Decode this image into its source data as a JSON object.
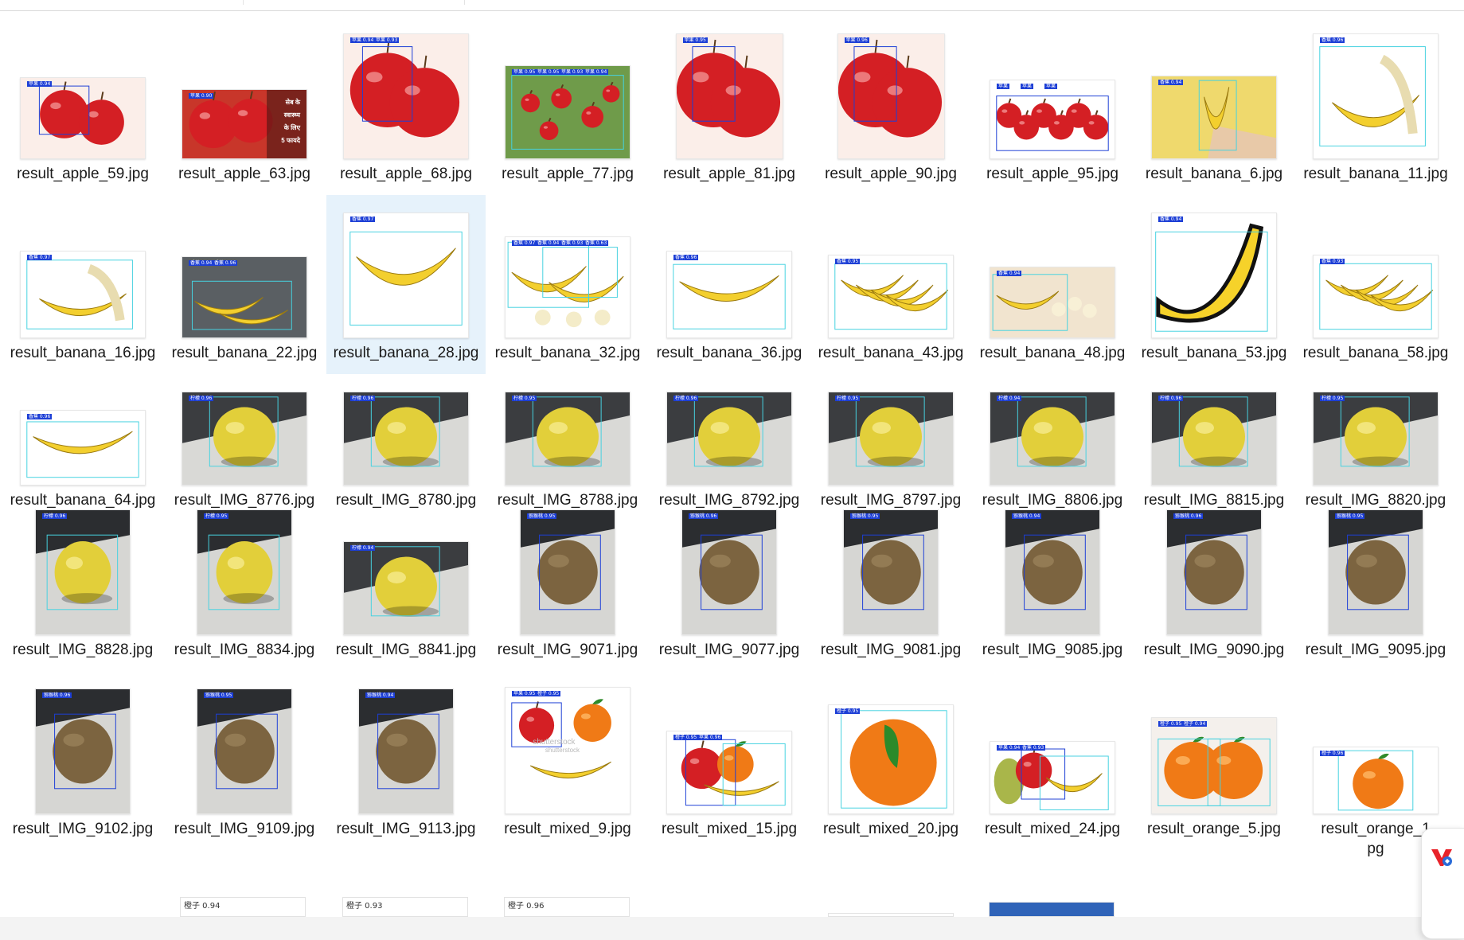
{
  "files": [
    {
      "name": "result_apple_59.jpg",
      "kind": "apple",
      "tags": [
        "苹果 0.94"
      ]
    },
    {
      "name": "result_apple_63.jpg",
      "kind": "apple-text",
      "tags": [
        "苹果 0.90"
      ],
      "overlay_text": [
        "सेब के",
        "स्वास्थ्य",
        "के लिए",
        "5 फायदे"
      ]
    },
    {
      "name": "result_apple_68.jpg",
      "kind": "apple",
      "tags": [
        "苹果 0.94",
        "苹果 0.93"
      ]
    },
    {
      "name": "result_apple_77.jpg",
      "kind": "apple-tree",
      "tags": [
        "苹果 0.95",
        "苹果 0.95",
        "苹果 0.93",
        "苹果 0.94"
      ]
    },
    {
      "name": "result_apple_81.jpg",
      "kind": "apple",
      "tags": [
        "苹果 0.95"
      ]
    },
    {
      "name": "result_apple_90.jpg",
      "kind": "apple",
      "tags": [
        "苹果 0.96"
      ]
    },
    {
      "name": "result_apple_95.jpg",
      "kind": "apple-many",
      "tags": [
        "苹果",
        "苹果",
        "苹果"
      ]
    },
    {
      "name": "result_banana_6.jpg",
      "kind": "banana-hand",
      "tags": [
        "香蕉 0.94"
      ]
    },
    {
      "name": "result_banana_11.jpg",
      "kind": "banana-peel",
      "tags": [
        "香蕉 0.96"
      ]
    },
    {
      "name": "result_banana_16.jpg",
      "kind": "banana-peel",
      "tags": [
        "香蕉 0.97"
      ]
    },
    {
      "name": "result_banana_22.jpg",
      "kind": "banana-wood",
      "tags": [
        "香蕉 0.94",
        "香蕉 0.96"
      ]
    },
    {
      "name": "result_banana_28.jpg",
      "kind": "banana",
      "tags": [
        "香蕉 0.97"
      ]
    },
    {
      "name": "result_banana_32.jpg",
      "kind": "banana-multi",
      "tags": [
        "香蕉 0.97",
        "香蕉 0.94",
        "香蕉 0.93",
        "香蕉 0.63"
      ]
    },
    {
      "name": "result_banana_36.jpg",
      "kind": "banana",
      "tags": [
        "香蕉 0.96"
      ]
    },
    {
      "name": "result_banana_43.jpg",
      "kind": "banana-bunch",
      "tags": [
        "香蕉 0.95"
      ]
    },
    {
      "name": "result_banana_48.jpg",
      "kind": "banana-sliced",
      "tags": [
        "香蕉 0.94"
      ]
    },
    {
      "name": "result_banana_53.jpg",
      "kind": "banana-cartoon",
      "tags": [
        "香蕉 0.94"
      ]
    },
    {
      "name": "result_banana_58.jpg",
      "kind": "banana-bunch",
      "tags": [
        "香蕉 0.93"
      ]
    },
    {
      "name": "result_banana_64.jpg",
      "kind": "banana",
      "tags": [
        "香蕉 0.96"
      ]
    },
    {
      "name": "result_IMG_8776.jpg",
      "kind": "lemon",
      "tags": [
        "柠檬 0.96"
      ]
    },
    {
      "name": "result_IMG_8780.jpg",
      "kind": "lemon",
      "tags": [
        "柠檬 0.96"
      ]
    },
    {
      "name": "result_IMG_8788.jpg",
      "kind": "lemon",
      "tags": [
        "柠檬 0.95"
      ]
    },
    {
      "name": "result_IMG_8792.jpg",
      "kind": "lemon",
      "tags": [
        "柠檬 0.96"
      ]
    },
    {
      "name": "result_IMG_8797.jpg",
      "kind": "lemon",
      "tags": [
        "柠檬 0.95"
      ]
    },
    {
      "name": "result_IMG_8806.jpg",
      "kind": "lemon",
      "tags": [
        "柠檬 0.94"
      ]
    },
    {
      "name": "result_IMG_8815.jpg",
      "kind": "lemon",
      "tags": [
        "柠檬 0.96"
      ]
    },
    {
      "name": "result_IMG_8820.jpg",
      "kind": "lemon",
      "tags": [
        "柠檬 0.95"
      ]
    },
    {
      "name": "result_IMG_8828.jpg",
      "kind": "lemon-tall",
      "tags": [
        "柠檬 0.96"
      ]
    },
    {
      "name": "result_IMG_8834.jpg",
      "kind": "lemon-tall",
      "tags": [
        "柠檬 0.95"
      ]
    },
    {
      "name": "result_IMG_8841.jpg",
      "kind": "lemon",
      "tags": [
        "柠檬 0.94"
      ]
    },
    {
      "name": "result_IMG_9071.jpg",
      "kind": "kiwi-tall",
      "tags": [
        "猕猴桃 0.95"
      ]
    },
    {
      "name": "result_IMG_9077.jpg",
      "kind": "kiwi-tall",
      "tags": [
        "猕猴桃 0.96"
      ]
    },
    {
      "name": "result_IMG_9081.jpg",
      "kind": "kiwi-tall",
      "tags": [
        "猕猴桃 0.95"
      ]
    },
    {
      "name": "result_IMG_9085.jpg",
      "kind": "kiwi-tall",
      "tags": [
        "猕猴桃 0.94"
      ]
    },
    {
      "name": "result_IMG_9090.jpg",
      "kind": "kiwi-tall",
      "tags": [
        "猕猴桃 0.96"
      ]
    },
    {
      "name": "result_IMG_9095.jpg",
      "kind": "kiwi-tall",
      "tags": [
        "猕猴桃 0.95"
      ]
    },
    {
      "name": "result_IMG_9102.jpg",
      "kind": "kiwi-tall",
      "tags": [
        "猕猴桃 0.96"
      ]
    },
    {
      "name": "result_IMG_9109.jpg",
      "kind": "kiwi-tall",
      "tags": [
        "猕猴桃 0.95"
      ]
    },
    {
      "name": "result_IMG_9113.jpg",
      "kind": "kiwi-tall",
      "tags": [
        "猕猴桃 0.94"
      ]
    },
    {
      "name": "result_mixed_9.jpg",
      "kind": "mixed-stock",
      "tags": [
        "苹果 0.95",
        "橙子 0.95"
      ],
      "overlay_text": [
        "shutterstock"
      ]
    },
    {
      "name": "result_mixed_15.jpg",
      "kind": "mixed",
      "tags": [
        "橙子 0.95",
        "苹果 0.96"
      ]
    },
    {
      "name": "result_mixed_20.jpg",
      "kind": "orange-leaf",
      "tags": [
        "橙子 0.95"
      ]
    },
    {
      "name": "result_mixed_24.jpg",
      "kind": "mixed-pear",
      "tags": [
        "苹果 0.94",
        "香蕉 0.93"
      ]
    },
    {
      "name": "result_orange_5.jpg",
      "kind": "orange-pair",
      "tags": [
        "橙子 0.95",
        "橙子 0.94"
      ]
    },
    {
      "name": "result_orange_1",
      "kind": "orange",
      "tags": [
        "橙子 0.96"
      ],
      "caption_line2": "pg"
    }
  ],
  "selected_index": 11,
  "partial_row": [
    {
      "label": "橙子 0.94"
    },
    {
      "label": "橙子 0.93"
    },
    {
      "label": "橙子 0.96"
    },
    {
      "label": ""
    },
    {
      "label": ""
    }
  ],
  "floating_button": {
    "icon": "vs-logo-icon"
  },
  "colors": {
    "selection": "#e6f2fb",
    "detection_box": "#1d3fd6",
    "detection_box_alt": "#46d2e0",
    "apple": "#d41f24",
    "banana": "#f3cf2e",
    "lemon": "#e2cf3a",
    "kiwi": "#7c6440",
    "orange": "#f07a16"
  }
}
